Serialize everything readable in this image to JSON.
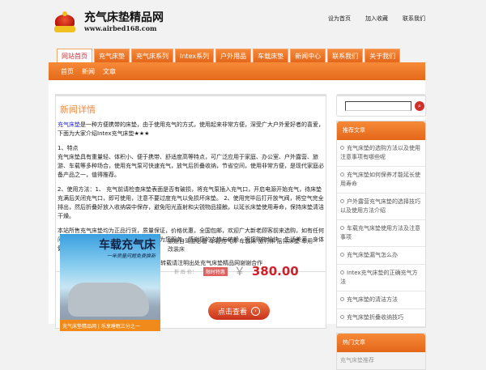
{
  "logo": {
    "name": "充气床垫精品网",
    "url": "www.airbed168.com"
  },
  "toplinks": [
    "设为首页",
    "加入收藏",
    "联系我们"
  ],
  "nav": [
    "网站首页",
    "充气床垫",
    "充气床系列",
    "Intex系列",
    "户外用品",
    "车载床垫",
    "新闻中心",
    "联系我们",
    "关于我们"
  ],
  "subnav": [
    "首页",
    "新闻",
    "文章"
  ],
  "article": {
    "title": "新闻详情",
    "link": "充气床垫",
    "p1": "是一种方便携带的床垫，由于使用充气的方式，使用起来非常方便，深受广大户外爱好者的喜爱，下面为大家介绍Intex充气床垫★★★",
    "p2a": "1、特点",
    "p2b": "充气床垫具有重量轻、体积小、便于携带、舒适度高等特点，可广泛应用于家庭、办公室、户外露营、旅游、车载等多种场合，使用充气泵可快速充气，放气后折叠收纳，节省空间，使用非常方便，是现代家庭必备产品之一，值得推荐。",
    "p3": "2、使用方法：1、 充气前请检查床垫表面是否有破损，将充气泵插入充气口，开启电源开始充气，待床垫充满后关闭充气口，即可使用，注意不要过度充气以免损坏床垫。 2、使用完毕后打开放气阀，将空气完全排出，然后折叠好放入收纳袋中保存，避免阳光直射和尖锐物品接触，以延长床垫使用寿命，保持床垫清洁干燥。",
    "p4": "本站所售充气床垫均为正品行货，质量保证，价格优惠，全国包邮，欢迎广大新老顾客前来选购，如有任何问题请联系我们的在线客服，我们将竭诚为您服务，感谢您的支持与信赖，祝您购物愉快，生活美满，身体健康，万事如意！",
    "footer": "本文来源于网络 转载请注明出处充气床垫精品网谢谢合作"
  },
  "product": {
    "img_title": "车载充气床",
    "img_sub": "一年质量问题免费换新",
    "img_strip": "充气床垫精品网 | 乐享睡眠三分之一",
    "name": "旅途自驾游必备 车载充气床 车震床 旅行床 后排床垫 车用改装床",
    "price_label": "折 后 价：",
    "badge": "限时特惠",
    "currency": "￥",
    "price": "380.00",
    "button": "点击查看"
  },
  "sidebar": {
    "search_value": "",
    "search_icon": "magnifier-icon",
    "section1": "推荐文章",
    "items": [
      "充气床垫的选购方法以及使用注意事项有哪些呢",
      "充气床垫如何保养才能延长使用寿命",
      "户外露营充气床垫的选择技巧以及使用方法介绍",
      "车载充气床垫使用方法及注意事项",
      "充气床垫漏气怎么办",
      "Intex充气床垫的正确充气方法",
      "充气床垫的清洁方法",
      "充气床垫折叠收纳技巧"
    ],
    "section2": "热门文章",
    "items2": [
      "充气床垫推荐"
    ]
  }
}
